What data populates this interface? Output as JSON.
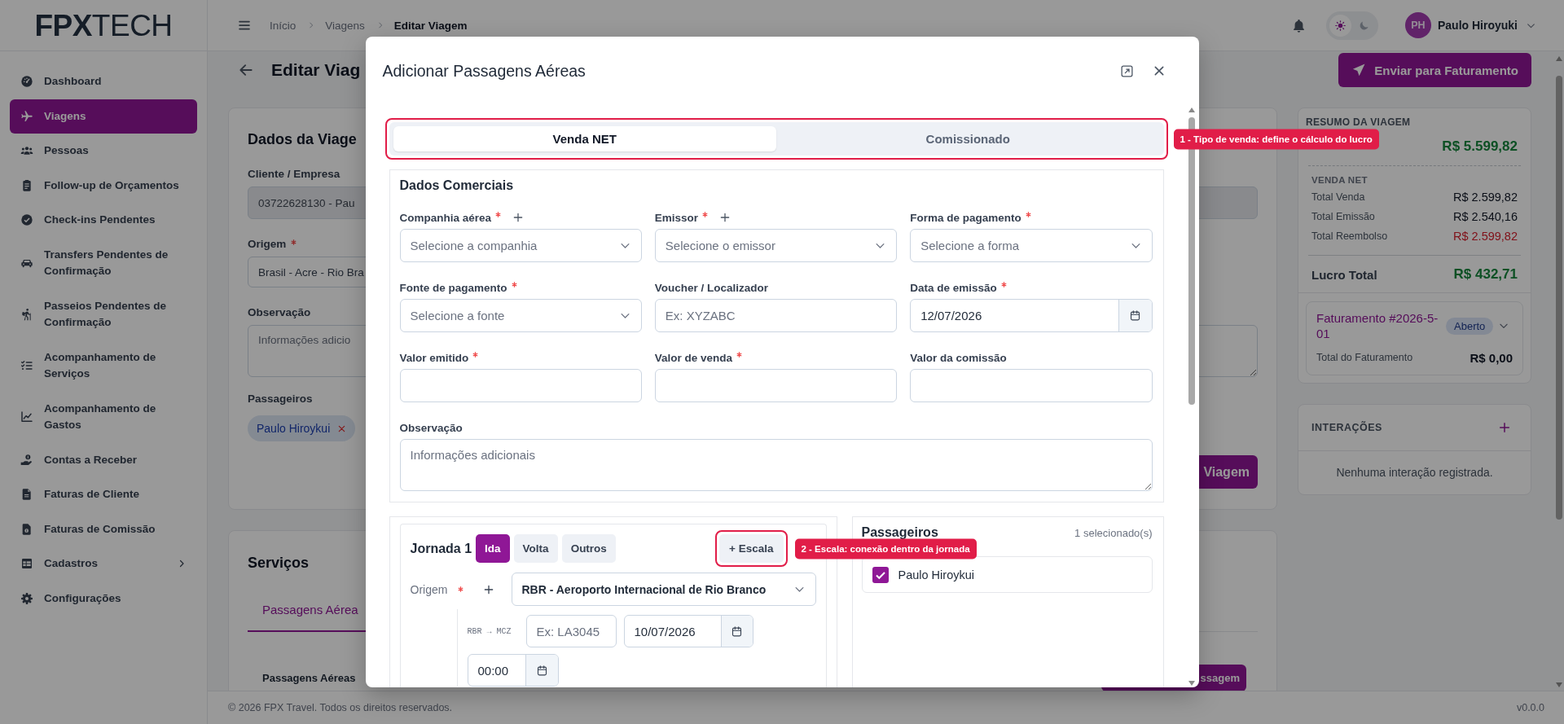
{
  "sidebar": {
    "logo": "**FPX**TECH",
    "items": [
      {
        "label": "Dashboard",
        "kind": "link",
        "selected": false
      },
      {
        "label": "Viagens",
        "kind": "link",
        "selected": true
      },
      {
        "label": "Pessoas",
        "kind": "link",
        "selected": false
      },
      {
        "label": "Follow-up de Orçamentos",
        "kind": "link",
        "selected": false
      },
      {
        "label": "Check-ins Pendentes",
        "kind": "link",
        "selected": false
      },
      {
        "label": "Transfers Pendentes de Confirmação",
        "kind": "link",
        "selected": false
      },
      {
        "label": "Passeios Pendentes de Confirmação",
        "kind": "link",
        "selected": false
      },
      {
        "label": "Acompanhamento de Serviços",
        "kind": "link",
        "selected": false
      },
      {
        "label": "Acompanhamento de Gastos",
        "kind": "link",
        "selected": false
      },
      {
        "label": "Contas a Receber",
        "kind": "link",
        "selected": false
      },
      {
        "label": "Faturas de Cliente",
        "kind": "link",
        "selected": false
      },
      {
        "label": "Faturas de Comissão",
        "kind": "link",
        "selected": false
      },
      {
        "label": "Cadastros",
        "kind": "group",
        "selected": false
      },
      {
        "label": "Configurações",
        "kind": "link",
        "selected": false
      }
    ]
  },
  "header": {
    "breadcrumb": [
      {
        "label": "Início",
        "current": false
      },
      {
        "label": "Viagens",
        "current": false
      },
      {
        "label": "Editar Viagem",
        "current": true
      }
    ],
    "theme_toggle": [
      {
        "kind": "light",
        "selected": true
      },
      {
        "kind": "dark",
        "selected": false
      }
    ],
    "user": {
      "initials": "PH",
      "name": "Paulo Hiroyuki"
    }
  },
  "page": {
    "title": "Editar Viag",
    "send_button": "Enviar para Faturamento",
    "trip": {
      "title": "Dados da Viage",
      "client": {
        "label": "Cliente / Empresa",
        "value": "03722628130 - Pau",
        "disabled": true
      },
      "origin": {
        "label": "Origem",
        "required": true,
        "value": "Brasil - Acre - Rio Bra"
      },
      "notes": {
        "label": "Observação",
        "placeholder": "Informações adicio"
      },
      "passengers": {
        "label": "Passageiros",
        "chips": [
          "Paulo Hiroykui"
        ]
      },
      "save_button": "Viagem"
    },
    "services": {
      "title": "Serviços",
      "tabs": [
        {
          "label": "Passagens Aérea",
          "selected": true
        }
      ],
      "section": "Passagens Aéreas",
      "add_button": "ssagem"
    },
    "summary": {
      "title": "RESUMO DA VIAGEM",
      "total": "R$ 5.599,82",
      "group": "VENDA NET",
      "rows": [
        {
          "label": "Total Venda",
          "value": "R$ 2.599,82",
          "negative": false
        },
        {
          "label": "Total Emissão",
          "value": "R$ 2.540,16",
          "negative": false
        },
        {
          "label": "Total Reembolso",
          "value": "R$ 2.599,82",
          "negative": true
        }
      ],
      "profit": {
        "label": "Lucro Total",
        "value": "R$ 432,71"
      },
      "invoice": {
        "title": "Faturamento #2026-5-01",
        "status": "Aberto",
        "expanded": false,
        "total_label": "Total do Faturamento",
        "total": "R$ 0,00"
      }
    },
    "interactions": {
      "title": "INTERAÇÕES",
      "empty": "Nenhuma interação registrada."
    }
  },
  "modal": {
    "title": "Adicionar Passagens Aéreas",
    "sale_types": {
      "note": "1 - Tipo de venda: define o cálculo do lucro",
      "options": [
        {
          "label": "Venda NET",
          "selected": true
        },
        {
          "label": "Comissionado",
          "selected": false
        }
      ]
    },
    "commercial": {
      "title": "Dados Comerciais",
      "fields": [
        {
          "label": "Companhia aérea",
          "required": true,
          "addable": true,
          "kind": "select",
          "placeholder": "Selecione a companhia"
        },
        {
          "label": "Emissor",
          "required": true,
          "addable": true,
          "kind": "select",
          "placeholder": "Selecione o emissor"
        },
        {
          "label": "Forma de pagamento",
          "required": true,
          "addable": false,
          "kind": "select",
          "placeholder": "Selecione a forma"
        },
        {
          "label": "Fonte de pagamento",
          "required": true,
          "addable": false,
          "kind": "select",
          "placeholder": "Selecione a fonte"
        },
        {
          "label": "Voucher / Localizador",
          "required": false,
          "addable": false,
          "kind": "text",
          "placeholder": "Ex: XYZABC"
        },
        {
          "label": "Data de emissão",
          "required": true,
          "addable": false,
          "kind": "date",
          "value": "12/07/2026"
        },
        {
          "label": "Valor emitido",
          "required": true,
          "addable": false,
          "kind": "text"
        },
        {
          "label": "Valor de venda",
          "required": true,
          "addable": false,
          "kind": "text"
        },
        {
          "label": "Valor da comissão",
          "required": false,
          "addable": false,
          "kind": "text"
        }
      ],
      "notes": {
        "label": "Observação",
        "placeholder": "Informações adicionais"
      }
    },
    "journey": {
      "title": "Jornada 1",
      "directions": [
        {
          "label": "Ida",
          "selected": true
        },
        {
          "label": "Volta",
          "selected": false
        },
        {
          "label": "Outros",
          "selected": false
        }
      ],
      "stopover": {
        "label": "+ Escala",
        "note": "2 - Escala: conexão dentro da jornada"
      },
      "origin": {
        "label": "Origem",
        "required": true,
        "addable": true,
        "value": "RBR - Aeroporto Internacional de Rio Branco"
      },
      "segment": {
        "route": "RBR → MCZ",
        "flight_placeholder": "Ex: LA3045",
        "date": "10/07/2026",
        "time": "00:00"
      }
    },
    "passengers": {
      "title": "Passageiros",
      "count": "1 selecionado(s)",
      "items": [
        {
          "name": "Paulo Hiroykui",
          "checked": true
        }
      ]
    }
  },
  "footer": {
    "copyright": "© 2026 FPX Travel. Todos os direitos reservados.",
    "version": "v0.0.0"
  }
}
